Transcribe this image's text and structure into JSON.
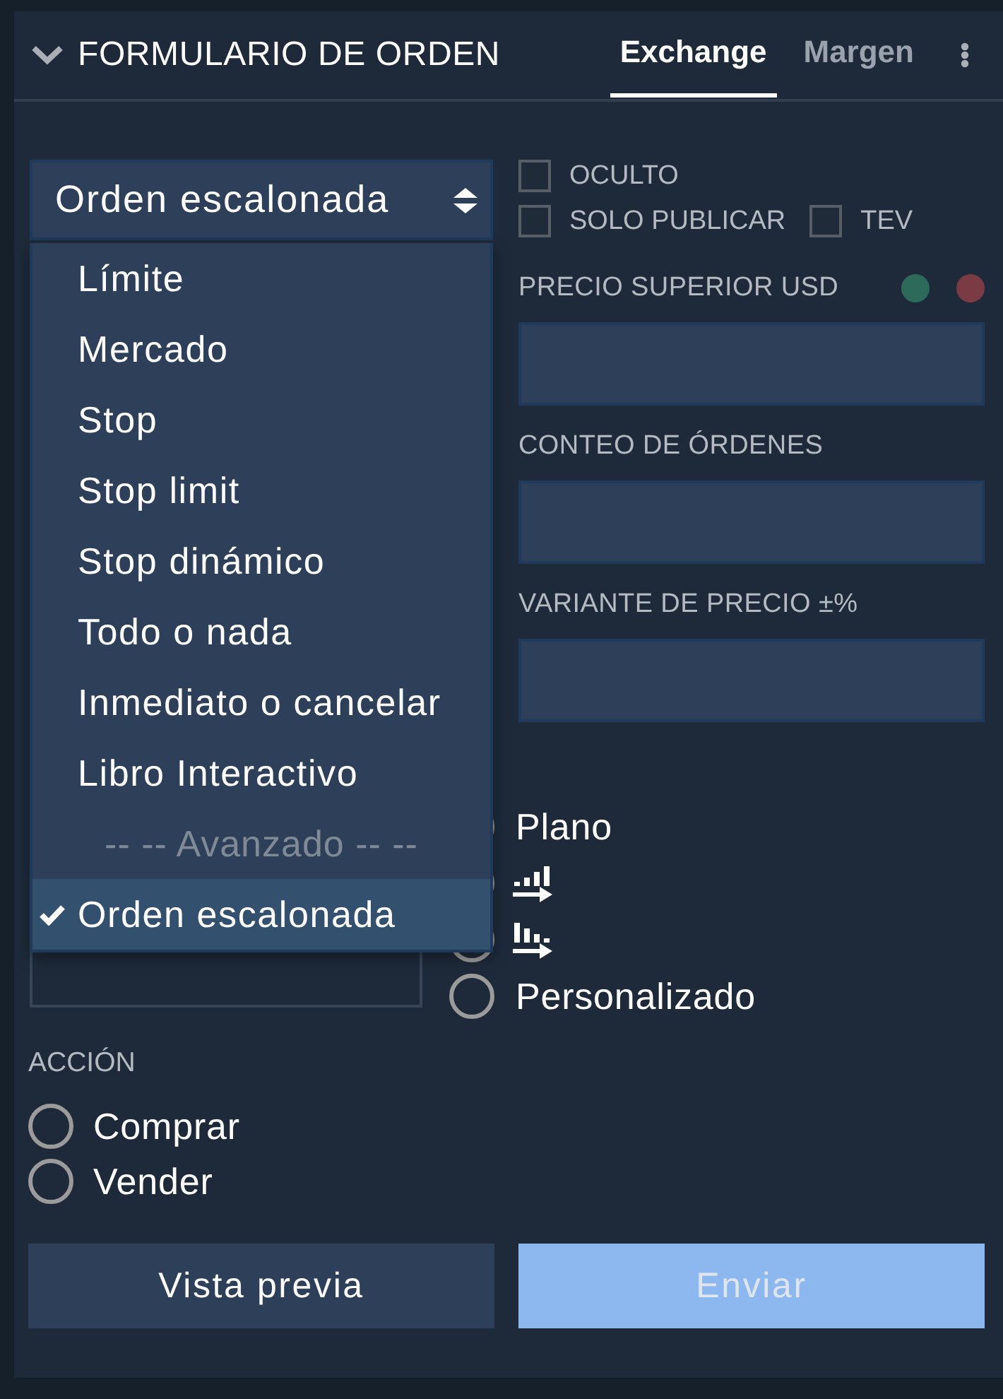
{
  "header": {
    "title": "FORMULARIO DE ORDEN",
    "expanded": true
  },
  "tabs": [
    {
      "label": "Exchange",
      "selected": true
    },
    {
      "label": "Margen",
      "selected": false
    }
  ],
  "order_type": {
    "value": "Orden escalonada",
    "expanded": true,
    "options": [
      {
        "kind": "option",
        "label": "Límite",
        "selected": false
      },
      {
        "kind": "option",
        "label": "Mercado",
        "selected": false
      },
      {
        "kind": "option",
        "label": "Stop",
        "selected": false
      },
      {
        "kind": "option",
        "label": "Stop limit",
        "selected": false
      },
      {
        "kind": "option",
        "label": "Stop dinámico",
        "selected": false
      },
      {
        "kind": "option",
        "label": "Todo o nada",
        "selected": false
      },
      {
        "kind": "option",
        "label": "Inmediato o cancelar",
        "selected": false
      },
      {
        "kind": "option",
        "label": "Libro Interactivo",
        "selected": false
      },
      {
        "kind": "group",
        "label": "-- -- Avanzado -- --",
        "selected": false
      },
      {
        "kind": "option",
        "label": "Orden escalonada",
        "selected": true
      }
    ]
  },
  "checkbox_rows": [
    {
      "items": [
        {
          "label": "OCULTO",
          "checked": false
        }
      ]
    },
    {
      "items": [
        {
          "label": "SOLO PUBLICAR",
          "checked": false
        },
        {
          "label": "TEV",
          "checked": false
        }
      ]
    }
  ],
  "fields": [
    {
      "label": "PRECIO SUPERIOR USD",
      "indicators": [
        {
          "color": "#2e6a5a"
        },
        {
          "color": "#7b3b44"
        }
      ]
    },
    {
      "label": "CONTEO DE ÓRDENES"
    },
    {
      "label": "VARIANTE DE PRECIO ±%"
    }
  ],
  "left_field": {
    "kind": "input"
  },
  "distribution": {
    "options": [
      {
        "kind": "text",
        "label": "Plano"
      },
      {
        "kind": "ascending"
      },
      {
        "kind": "descending",
        "selected": false
      },
      {
        "kind": "text",
        "label": "Personalizado",
        "selected": false
      }
    ]
  },
  "action": {
    "label": "ACCIÓN",
    "options": [
      {
        "label": "Comprar",
        "selected": false
      },
      {
        "label": "Vender",
        "selected": false
      }
    ]
  },
  "buttons": [
    {
      "kind": "secondary",
      "label": "Vista previa",
      "disabled": false
    },
    {
      "kind": "primary",
      "label": "Enviar",
      "disabled": true
    }
  ]
}
